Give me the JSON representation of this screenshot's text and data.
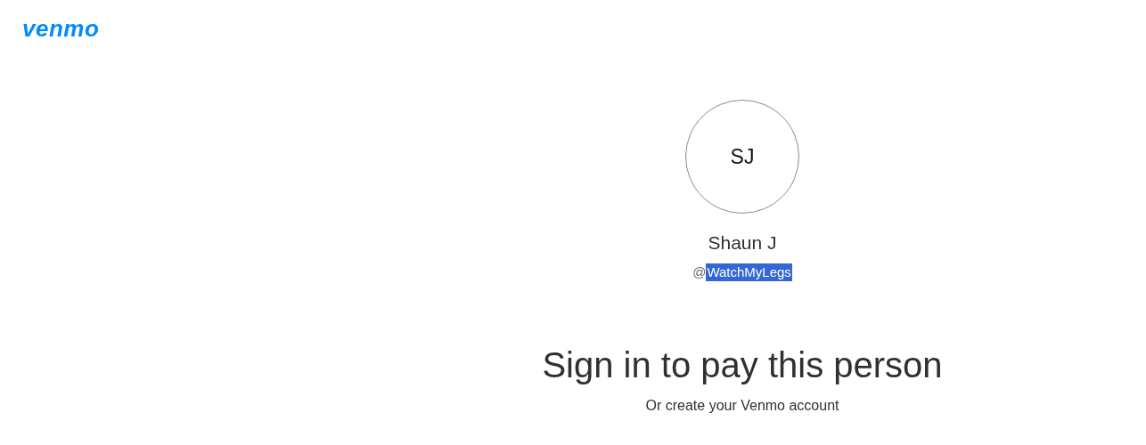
{
  "header": {
    "logo": "venmo"
  },
  "profile": {
    "initials": "SJ",
    "name": "Shaun J",
    "handle": {
      "prefix": "@",
      "username": "WatchMyLegs",
      "selected": true
    }
  },
  "heading": "Sign in to pay this person",
  "subtitle": "Or create your Venmo account"
}
